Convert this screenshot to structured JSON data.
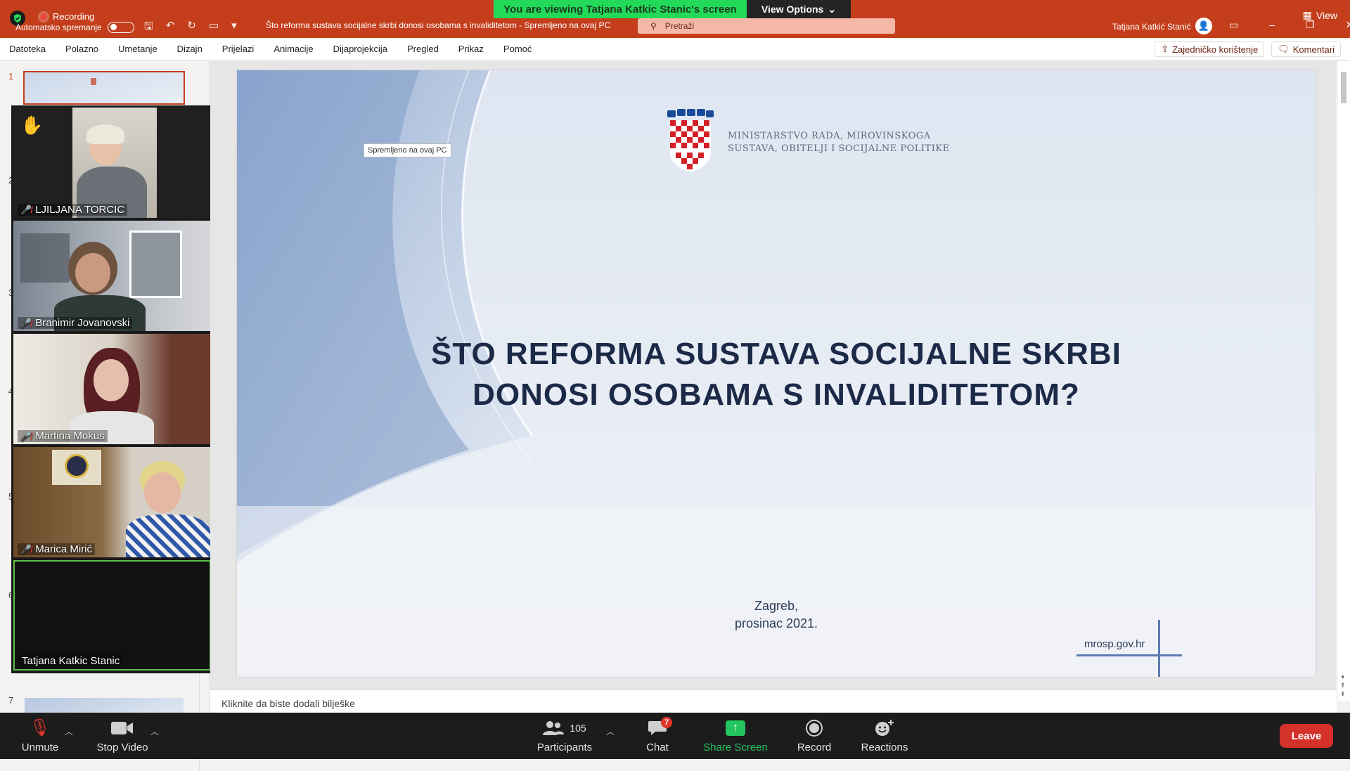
{
  "zoom": {
    "recording_label": "Recording",
    "viewing_banner": "You are viewing Tatjana Katkic Stanic's screen",
    "view_options": "View Options",
    "view_label": "View",
    "participants": [
      {
        "name": "LJILJANA TORCIC",
        "raised_hand": true
      },
      {
        "name": "Branimir Jovanovski"
      },
      {
        "name": "Martina Mokus"
      },
      {
        "name": "Marica Mirić"
      },
      {
        "name": "Tatjana Katkic Stanic",
        "active_speaker": true
      }
    ],
    "toolbar": {
      "unmute": "Unmute",
      "stop_video": "Stop Video",
      "participants_label": "Participants",
      "participants_count": "105",
      "chat": "Chat",
      "chat_badge": "7",
      "share_screen": "Share Screen",
      "record": "Record",
      "reactions": "Reactions",
      "leave": "Leave"
    },
    "colors": {
      "banner": "#23d959",
      "leave": "#d4312a",
      "share": "#22c55e"
    }
  },
  "powerpoint": {
    "autosave_label": "Automatsko spremanje",
    "doc_title": "Što reforma sustava socijalne skrbi donosi osobama s invaliditetom  -  Spremljeno na ovaj PC",
    "search_placeholder": "Pretraži",
    "user_name": "Tatjana Katkić Stanić",
    "menu": [
      "Datoteka",
      "Polazno",
      "Umetanje",
      "Dizajn",
      "Prijelazi",
      "Animacije",
      "Dijaprojekcija",
      "Pregled",
      "Prikaz",
      "Pomoć"
    ],
    "share_btn": "Zajedničko korištenje",
    "comments_btn": "Komentari",
    "tooltip": "Spremljeno na ovaj PC",
    "notes_placeholder": "Kliknite da biste dodali bilješke",
    "slide_numbers": [
      "1",
      "2",
      "3",
      "4",
      "5",
      "6",
      "7"
    ],
    "accent_color": "#c43e1c"
  },
  "slide": {
    "ministry_line1": "MINISTARSTVO RADA, MIROVINSKOGA",
    "ministry_line2": "SUSTAVA, OBITELJI I SOCIJALNE POLITIKE",
    "title_line1": "ŠTO REFORMA SUSTAVA SOCIJALNE SKRBI",
    "title_line2": "DONOSI OSOBAMA S INVALIDITETOM?",
    "place": "Zagreb,",
    "date": "prosinac 2021.",
    "url": "mrosp.gov.hr"
  }
}
